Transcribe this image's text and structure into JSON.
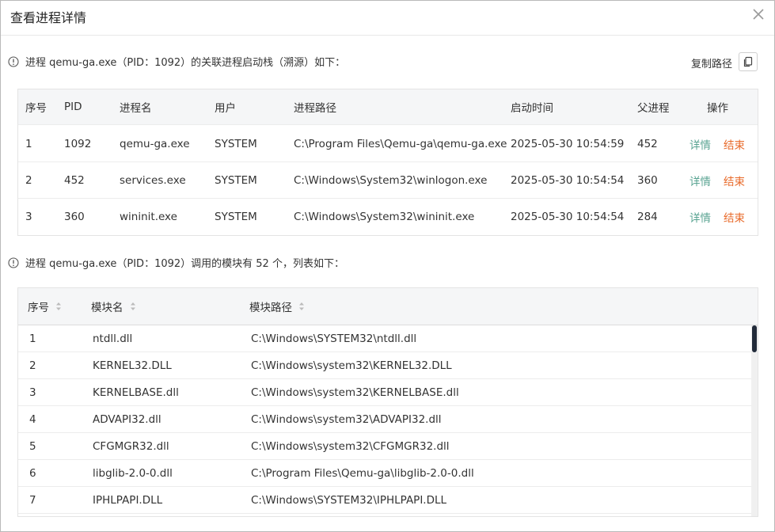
{
  "dialog": {
    "title": "查看进程详情",
    "close_icon": "close-icon"
  },
  "stack_info": {
    "text": "进程 qemu-ga.exe（PID：1092）的关联进程启动栈（溯源）如下："
  },
  "copy": {
    "label": "复制路径",
    "icon": "copy-icon"
  },
  "process_table": {
    "headers": [
      "序号",
      "PID",
      "进程名",
      "用户",
      "进程路径",
      "启动时间",
      "父进程",
      "操作"
    ],
    "rows": [
      {
        "index": "1",
        "pid": "1092",
        "name": "qemu-ga.exe",
        "user": "SYSTEM",
        "path": "C:\\Program Files\\Qemu-ga\\qemu-ga.exe",
        "start": "2025-05-30 10:54:59",
        "parent": "452",
        "detail": "详情",
        "end": "结束"
      },
      {
        "index": "2",
        "pid": "452",
        "name": "services.exe",
        "user": "SYSTEM",
        "path": "C:\\Windows\\System32\\winlogon.exe",
        "start": "2025-05-30 10:54:54",
        "parent": "360",
        "detail": "详情",
        "end": "结束"
      },
      {
        "index": "3",
        "pid": "360",
        "name": "wininit.exe",
        "user": "SYSTEM",
        "path": "C:\\Windows\\System32\\wininit.exe",
        "start": "2025-05-30 10:54:54",
        "parent": "284",
        "detail": "详情",
        "end": "结束"
      }
    ]
  },
  "module_info": {
    "text": "进程 qemu-ga.exe（PID：1092）调用的模块有 52 个，列表如下："
  },
  "module_table": {
    "headers": [
      "序号",
      "模块名",
      "模块路径"
    ],
    "rows": [
      {
        "index": "1",
        "name": "ntdll.dll",
        "path": "C:\\Windows\\SYSTEM32\\ntdll.dll"
      },
      {
        "index": "2",
        "name": "KERNEL32.DLL",
        "path": "C:\\Windows\\system32\\KERNEL32.DLL"
      },
      {
        "index": "3",
        "name": "KERNELBASE.dll",
        "path": "C:\\Windows\\system32\\KERNELBASE.dll"
      },
      {
        "index": "4",
        "name": "ADVAPI32.dll",
        "path": "C:\\Windows\\system32\\ADVAPI32.dll"
      },
      {
        "index": "5",
        "name": "CFGMGR32.dll",
        "path": "C:\\Windows\\system32\\CFGMGR32.dll"
      },
      {
        "index": "6",
        "name": "libglib-2.0-0.dll",
        "path": "C:\\Program Files\\Qemu-ga\\libglib-2.0-0.dll"
      },
      {
        "index": "7",
        "name": "IPHLPAPI.DLL",
        "path": "C:\\Windows\\SYSTEM32\\IPHLPAPI.DLL"
      }
    ]
  },
  "colors": {
    "detail": "#58a391",
    "end": "#e86a2a",
    "header_bg": "#f5f6f7",
    "scroll_thumb": "#222b3a"
  }
}
